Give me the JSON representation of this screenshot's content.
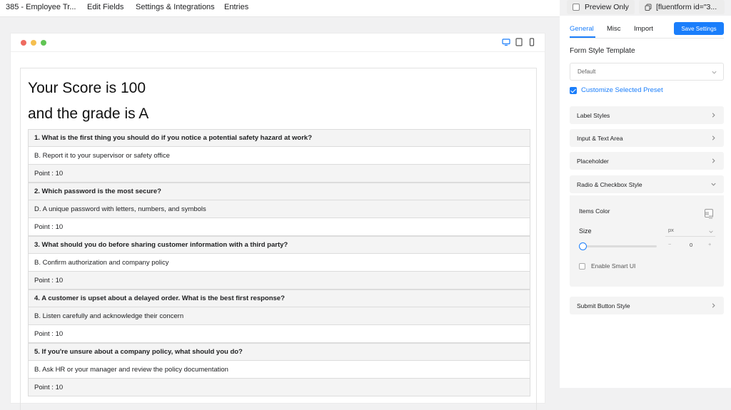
{
  "top_nav": {
    "form_title": "385 - Employee Tr...",
    "edit_fields": "Edit Fields",
    "settings": "Settings & Integrations",
    "entries": "Entries"
  },
  "header_actions": {
    "preview_only": "Preview Only",
    "shortcode": "[fluentform id=\"3..."
  },
  "preview": {
    "score_line": "Your Score is 100",
    "grade_line": "and the grade is A",
    "questions": [
      {
        "question": "1. What is the first thing you should do if you notice a potential safety hazard at work?",
        "answer": "B. Report it to your supervisor or safety office",
        "point": "Point : 10"
      },
      {
        "question": "2. Which password is the most secure?",
        "answer": "D. A unique password with letters, numbers, and symbols",
        "point": "Point : 10"
      },
      {
        "question": "3. What should you do before sharing customer information with a third party?",
        "answer": "B. Confirm authorization and company policy",
        "point": "Point : 10"
      },
      {
        "question": "4. A customer is upset about a delayed order. What is the best first response?",
        "answer": "B. Listen carefully and acknowledge their concern",
        "point": "Point : 10"
      },
      {
        "question": "5. If you're unsure about a company policy, what should you do?",
        "answer": "B. Ask HR or your manager and review the policy documentation",
        "point": "Point : 10"
      }
    ]
  },
  "sidebar": {
    "tabs": [
      "General",
      "Misc",
      "Import"
    ],
    "save_label": "Save Settings",
    "form_style_template_label": "Form Style Template",
    "template_value": "Default",
    "customize_label": "Customize Selected Preset",
    "accordions": {
      "label_styles": "Label Styles",
      "input_text_area": "Input & Text Area",
      "placeholder": "Placeholder",
      "radio_checkbox": "Radio & Checkbox Style",
      "submit_button": "Submit Button Style"
    },
    "radio_panel": {
      "items_color": "Items Color",
      "size_label": "Size",
      "unit": "px",
      "size_value": "0",
      "minus": "−",
      "plus": "+",
      "smart_ui": "Enable Smart UI"
    }
  },
  "colors": {
    "accent": "#1a7efb",
    "dot_red": "#ee6b60",
    "dot_yellow": "#f5bf4f",
    "dot_green": "#61c554"
  }
}
